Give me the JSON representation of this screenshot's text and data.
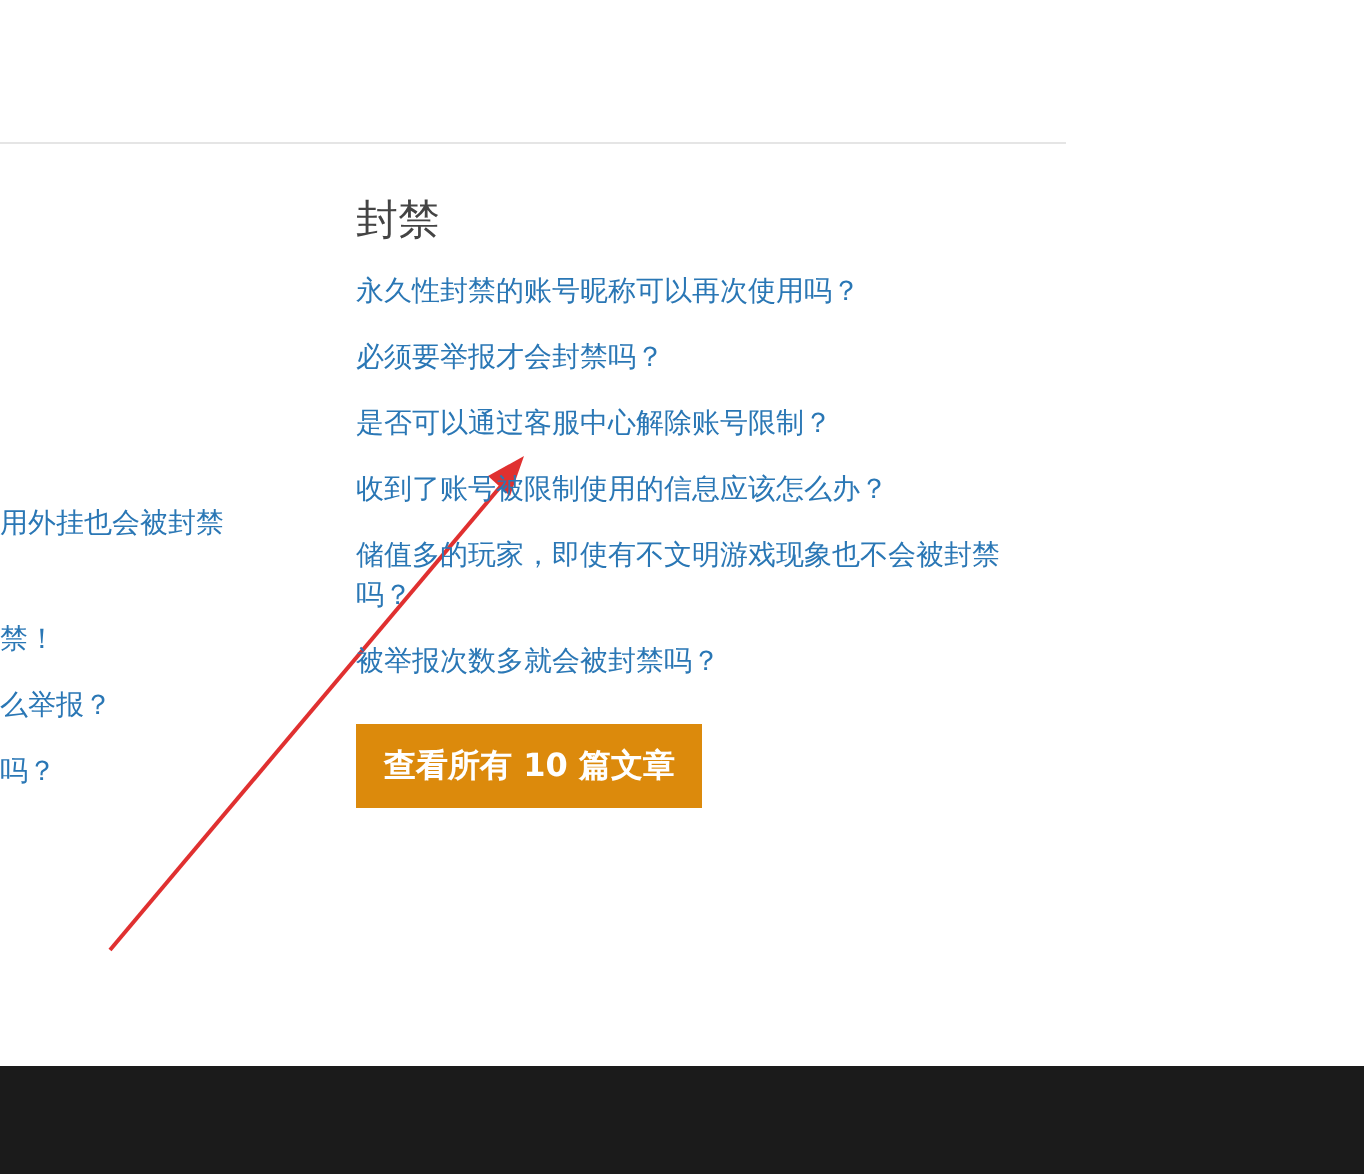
{
  "left_column": {
    "links": [
      {
        "text": "用外挂也会被封禁"
      },
      {
        "text": "禁！"
      },
      {
        "text": "么举报？"
      },
      {
        "text": "吗？"
      }
    ]
  },
  "ban_section": {
    "heading": "封禁",
    "links": [
      {
        "text": "永久性封禁的账号昵称可以再次使用吗？"
      },
      {
        "text": "必须要举报才会封禁吗？"
      },
      {
        "text": "是否可以通过客服中心解除账号限制？"
      },
      {
        "text": "收到了账号被限制使用的信息应该怎么办？"
      },
      {
        "text": "储值多的玩家，即使有不文明游戏现象也不会被封禁吗？"
      },
      {
        "text": "被举报次数多就会被封禁吗？"
      }
    ],
    "button": "查看所有 10 篇文章"
  }
}
